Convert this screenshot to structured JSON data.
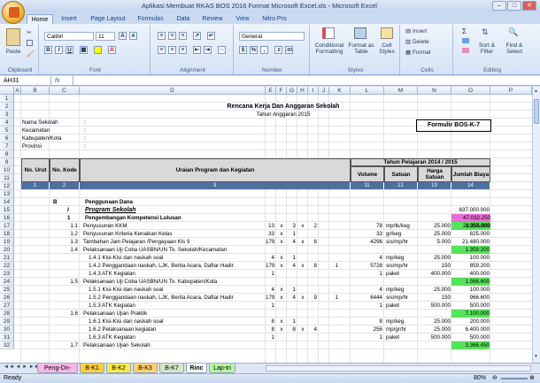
{
  "window": {
    "title": "Aplikasi Membuat RKAS BOS 2016 Format Microsoft Excel.xls - Microsoft Excel"
  },
  "tabs": [
    "Home",
    "Insert",
    "Page Layout",
    "Formulas",
    "Data",
    "Review",
    "View",
    "Nitro Pro"
  ],
  "ribbon": {
    "paste": "Paste",
    "clipboard": "Clipboard",
    "font_group": "Font",
    "font_name": "Calibri",
    "font_size": "11",
    "alignment": "Alignment",
    "number_group": "Number",
    "number_format": "General",
    "cond_format": "Conditional Formatting",
    "format_table": "Format as Table",
    "cell_styles": "Cell Styles",
    "styles": "Styles",
    "insert": "Insert",
    "delete": "Delete",
    "format": "Format",
    "cells": "Cells",
    "sort_filter": "Sort & Filter",
    "find_select": "Find & Select",
    "editing": "Editing",
    "bold": "B",
    "italic": "I",
    "underline": "U"
  },
  "formula_bar": {
    "name_box": "AH31",
    "fx": "fx",
    "value": ""
  },
  "columns": [
    "A",
    "B",
    "C",
    "D",
    "E",
    "F",
    "G",
    "H",
    "I",
    "J",
    "K",
    "L",
    "M",
    "N",
    "O",
    "P"
  ],
  "rows": [
    "1",
    "2",
    "3",
    "4",
    "5",
    "6",
    "7",
    "8",
    "9",
    "10",
    "11",
    "12",
    "13",
    "14",
    "15",
    "16",
    "17",
    "18",
    "19",
    "20",
    "21",
    "22",
    "23",
    "24",
    "25",
    "26",
    "27",
    "28",
    "29",
    "30",
    "31",
    "32"
  ],
  "sheet": {
    "title": "Rencana Kerja Dan Anggaran Sekolah",
    "subtitle": "Tahun Anggaran 2015",
    "info_labels": [
      "Nama Sekolah",
      "Kecamatan",
      "Kabupaten/Kota",
      "Provinsi"
    ],
    "colon": ":",
    "formulir": "Formulir BOS-K-7",
    "headers": {
      "no_urut": "No. Urut",
      "no_kode": "No. Kode",
      "uraian": "Uraian Program dan Kegiatan",
      "tahun": "Tahun Pelajaran 2014 / 2015",
      "volume": "Volume",
      "satuan": "Satuan",
      "harga": "Harga Satuan",
      "jumlah": "Jumlah Biaya"
    },
    "col_numbers": [
      "1",
      "2",
      "3",
      "11",
      "12",
      "13",
      "14"
    ],
    "B_label": "B",
    "penggunaan": "Penggunaan Dana",
    "roman": "I",
    "program": "Program Sekolah",
    "no1": "1",
    "pengembangan": "Pengembangan Kompetensi Lulusan",
    "totals": {
      "r14": "637.000.000",
      "r15": "47.032.250",
      "r16": "24.255.000"
    },
    "lines": [
      {
        "row": 17,
        "code": "1.1",
        "desc": "Penyusunan KKM",
        "e": "13",
        "x1": "x",
        "g": "3",
        "x2": "x",
        "i": "2",
        "k": "",
        "l": "78",
        "sat": "mp/tk/keg",
        "harga": "25.000",
        "jml": "1.950.000"
      },
      {
        "row": 18,
        "code": "1.2",
        "desc": "Penyusunan Kriteria Kenaikan Kelas",
        "e": "33",
        "x1": "x",
        "g": "1",
        "x2": "",
        "i": "",
        "k": "",
        "l": "33",
        "sat": "gr/keg",
        "harga": "25.000",
        "jml": "825.000"
      },
      {
        "row": 19,
        "code": "1.3",
        "desc": "Tambahan Jam Pelajaran /Pengayaan Kls 9",
        "e": "179",
        "x1": "x",
        "g": "4",
        "x2": "x",
        "i": "6",
        "k": "",
        "l": "4296",
        "sat": "sis/mp/hr",
        "harga": "5.000",
        "jml": "21.480.000"
      },
      {
        "row": 20,
        "code": "1.4",
        "desc": "Pelaksanaan Uji Coba UASBN/UN Tk. Sekolah/Kecamatan",
        "e": "",
        "x1": "",
        "g": "",
        "x2": "",
        "i": "",
        "k": "",
        "l": "",
        "sat": "",
        "harga": "",
        "jml": "1.359.200"
      },
      {
        "row": 21,
        "code": "",
        "desc": "1.4.1 Kisi-Kisi dan naskah soal",
        "e": "4",
        "x1": "x",
        "g": "1",
        "x2": "",
        "i": "",
        "k": "",
        "l": "4",
        "sat": "mp/keg",
        "harga": "25.000",
        "jml": "100.000"
      },
      {
        "row": 22,
        "code": "",
        "desc": "1.4.2 Penggandaan naskah, LJK, Berita Acara, Daftar Hadir",
        "e": "179",
        "x1": "x",
        "g": "4",
        "x2": "x",
        "i": "8",
        "k": "1",
        "l": "5728",
        "sat": "sis/mp/hr",
        "harga": "150",
        "jml": "859.200"
      },
      {
        "row": 23,
        "code": "",
        "desc": "1.4.3 ATK Kegiatan",
        "e": "1",
        "x1": "",
        "g": "",
        "x2": "",
        "i": "",
        "k": "",
        "l": "1",
        "sat": "paket",
        "harga": "400.000",
        "jml": "400.000"
      },
      {
        "row": 24,
        "code": "1.5",
        "desc": "Pelaksanaan Uji Coba UASBN/UN Tk. Kabupaten/Kota",
        "e": "",
        "x1": "",
        "g": "",
        "x2": "",
        "i": "",
        "k": "",
        "l": "",
        "sat": "",
        "harga": "",
        "jml": "1.566.600"
      },
      {
        "row": 25,
        "code": "",
        "desc": "1.5.1 Kisi-Kisi dan naskah soal",
        "e": "4",
        "x1": "x",
        "g": "1",
        "x2": "",
        "i": "",
        "k": "",
        "l": "4",
        "sat": "mp/keg",
        "harga": "25.000",
        "jml": "100.000"
      },
      {
        "row": 26,
        "code": "",
        "desc": "1.5.2 Penggandaan naskah, LJK, Berita Acara, Daftar Hadir",
        "e": "179",
        "x1": "x",
        "g": "4",
        "x2": "x",
        "i": "9",
        "k": "1",
        "l": "6444",
        "sat": "sis/mp/hr",
        "harga": "150",
        "jml": "966.600"
      },
      {
        "row": 27,
        "code": "",
        "desc": "1.5.3 ATK Kegiatan",
        "e": "1",
        "x1": "",
        "g": "",
        "x2": "",
        "i": "",
        "k": "",
        "l": "1",
        "sat": "paket",
        "harga": "500.000",
        "jml": "500.000"
      },
      {
        "row": 28,
        "code": "1.6",
        "desc": "Pelaksanaan Ujian Praktik",
        "e": "",
        "x1": "",
        "g": "",
        "x2": "",
        "i": "",
        "k": "",
        "l": "",
        "sat": "",
        "harga": "",
        "jml": "7.100.000"
      },
      {
        "row": 29,
        "code": "",
        "desc": "1.6.1 Kisi-Kisi dan naskah soal",
        "e": "8",
        "x1": "x",
        "g": "1",
        "x2": "",
        "i": "",
        "k": "",
        "l": "8",
        "sat": "mp/keg",
        "harga": "25.000",
        "jml": "200.000"
      },
      {
        "row": 30,
        "code": "",
        "desc": "1.6.2 Pelaksanaan kegiatan",
        "e": "8",
        "x1": "x",
        "g": "8",
        "x2": "x",
        "i": "4",
        "k": "",
        "l": "256",
        "sat": "mp/gr/hr",
        "harga": "25.000",
        "jml": "6.400.000"
      },
      {
        "row": 31,
        "code": "",
        "desc": "1.6.3 ATK Kegiatan",
        "e": "1",
        "x1": "",
        "g": "",
        "x2": "",
        "i": "",
        "k": "",
        "l": "1",
        "sat": "paket",
        "harga": "500.000",
        "jml": "500.000"
      },
      {
        "row": 32,
        "code": "1.7",
        "desc": "Pelaksanaan Ujian Sekolah",
        "e": "",
        "x1": "",
        "g": "",
        "x2": "",
        "i": "",
        "k": "",
        "l": "",
        "sat": "",
        "harga": "",
        "jml": "3.366.450"
      }
    ]
  },
  "sheet_tabs": [
    "Peng-Dn-BOS",
    "B-K1",
    "B-K2",
    "B-K3",
    "B-K7",
    "Rinc",
    "Lap-tri"
  ],
  "status": {
    "ready": "Ready",
    "zoom": "80%"
  },
  "colors": {
    "pink": "#ea6fd6",
    "green": "#55e35b",
    "header_blue": "#4f6f9f",
    "accent": "#15428b"
  }
}
